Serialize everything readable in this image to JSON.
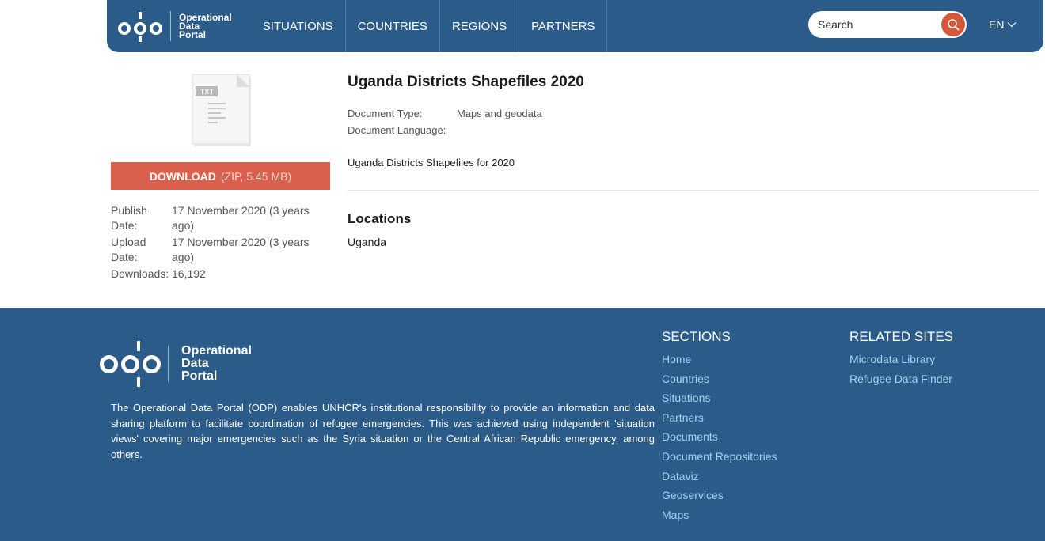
{
  "header": {
    "logo_line1": "Operational",
    "logo_line2": "Data",
    "logo_line3": "Portal",
    "nav": [
      "SITUATIONS",
      "COUNTRIES",
      "REGIONS",
      "PARTNERS"
    ],
    "search_placeholder": "Search",
    "language": "EN"
  },
  "document": {
    "icon_label": "TXT",
    "download_label": "DOWNLOAD",
    "download_meta": "(ZIP, 5.45 MB)",
    "meta": [
      {
        "label": "Publish Date:",
        "value": "17 November 2020 (3 years ago)"
      },
      {
        "label": "Upload Date:",
        "value": "17 November 2020 (3 years ago)"
      },
      {
        "label": "Downloads:",
        "value": "16,192"
      }
    ],
    "title": "Uganda Districts Shapefiles 2020",
    "type_label": "Document Type:",
    "type_value": "Maps and geodata",
    "language_label": "Document Language:",
    "language_value": "",
    "description": "Uganda Districts Shapefiles for 2020",
    "locations_title": "Locations",
    "locations": [
      "Uganda"
    ]
  },
  "footer": {
    "logo_line1": "Operational",
    "logo_line2": "Data",
    "logo_line3": "Portal",
    "about": "The Operational Data Portal (ODP) enables UNHCR's institutional responsibility to provide an information and data sharing platform to facilitate coordination of refugee emergencies. This was achieved using independent 'situation views' covering major emergencies such as the Syria situation or the Central African Republic emergency, among others.",
    "sections_title": "SECTIONS",
    "sections": [
      "Home",
      "Countries",
      "Situations",
      "Partners",
      "Documents",
      "Document Repositories",
      "Dataviz",
      "Geoservices",
      "Maps"
    ],
    "related_title": "RELATED SITES",
    "related": [
      "Microdata Library",
      "Refugee Data Finder"
    ]
  },
  "colors": {
    "brand_blue": "#2b5b89",
    "download_red": "#d9604c",
    "footer_link": "#9fd3f5"
  }
}
